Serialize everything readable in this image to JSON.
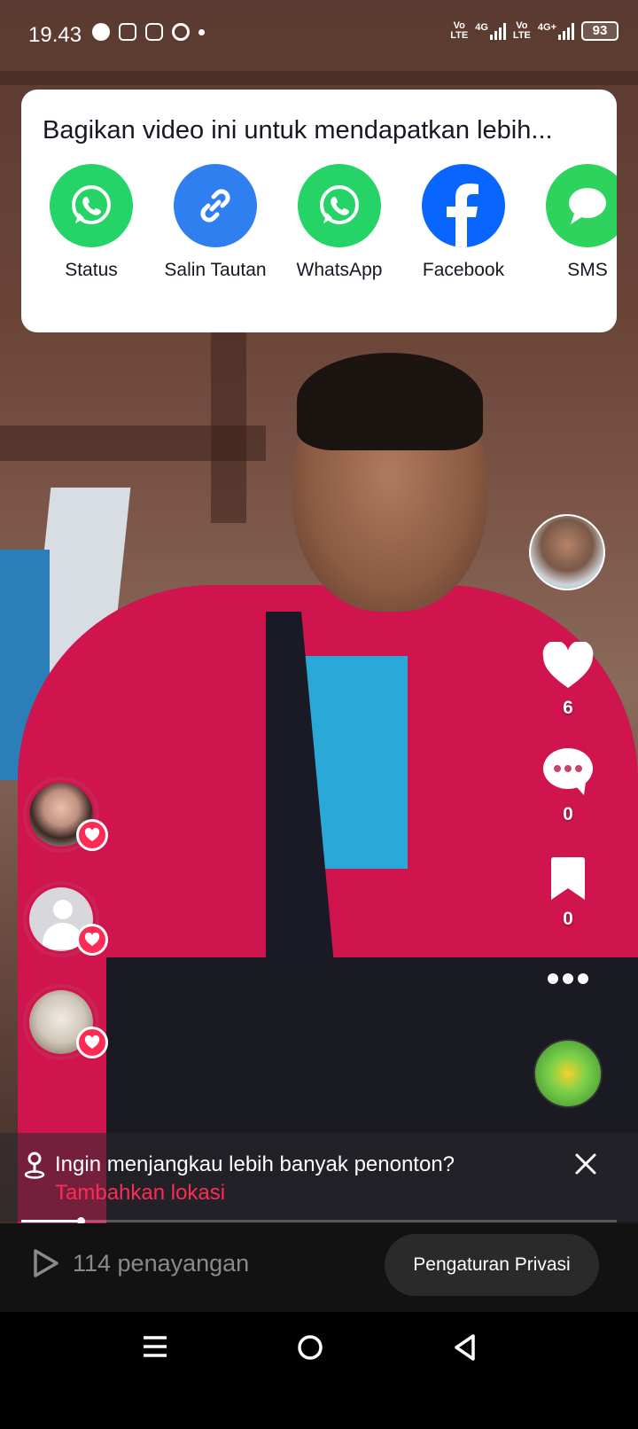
{
  "status_bar": {
    "time": "19.43",
    "network_1_top": "Vo",
    "network_1_bottom": "LTE",
    "signal_1": "4G",
    "network_2_top": "Vo",
    "network_2_bottom": "LTE",
    "signal_2": "4G+",
    "battery": "93"
  },
  "share_sheet": {
    "title": "Bagikan video ini untuk mendapatkan lebih...",
    "items": [
      {
        "label": "Status",
        "icon": "whatsapp-status-icon",
        "color": "#25d366"
      },
      {
        "label": "Salin Tautan",
        "icon": "link-icon",
        "color": "#2f7ff0"
      },
      {
        "label": "WhatsApp",
        "icon": "whatsapp-icon",
        "color": "#25d366"
      },
      {
        "label": "Facebook",
        "icon": "facebook-icon",
        "color": "#0866ff"
      },
      {
        "label": "SMS",
        "icon": "sms-icon",
        "color": "#2ed35e"
      }
    ]
  },
  "side_actions": {
    "likes": "6",
    "comments": "0",
    "saves": "0"
  },
  "location_banner": {
    "text": "Ingin menjangkau lebih banyak penonton?",
    "link": "Tambahkan lokasi"
  },
  "video_progress": 0.1,
  "bottom": {
    "views": "114 penayangan",
    "privacy_button": "Pengaturan Privasi"
  },
  "colors": {
    "accent": "#fe2c55"
  }
}
